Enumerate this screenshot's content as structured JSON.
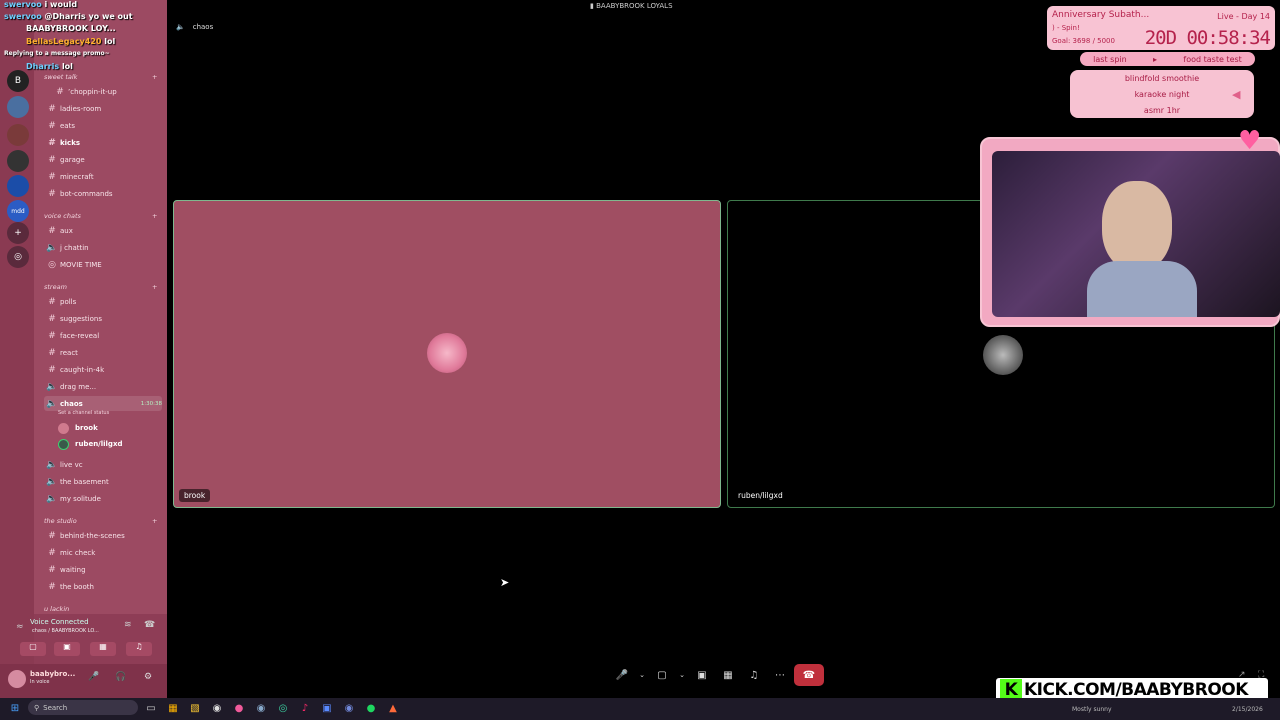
{
  "window": {
    "title": "BAABYBROOK LOYALS"
  },
  "chat": [
    {
      "user": "swervoo",
      "text": "i would"
    },
    {
      "user": "swervoo",
      "text": "@Dharris yo we out"
    },
    {
      "user": "",
      "text": "BAABYBROOK LOY..."
    },
    {
      "user": "BellasLegacy420",
      "text": "lol"
    },
    {
      "user": "",
      "text": "Replying to a message promo~"
    },
    {
      "user": "Dharris",
      "text": "lol"
    }
  ],
  "sidebar": {
    "categories": [
      {
        "label": "sweet talk",
        "channels": [
          {
            "label": "’choppin-it-up"
          },
          {
            "label": "ladies-room"
          },
          {
            "label": "eats"
          },
          {
            "label": "kicks"
          },
          {
            "label": "garage"
          },
          {
            "label": "minecraft"
          },
          {
            "label": "bot-commands"
          }
        ]
      },
      {
        "label": "voice chats",
        "channels": [
          {
            "label": "aux"
          },
          {
            "label": "j chattin"
          },
          {
            "label": "MOVIE TIME"
          }
        ]
      },
      {
        "label": "stream",
        "channels": [
          {
            "label": "polls"
          },
          {
            "label": "suggestions"
          },
          {
            "label": "face-reveal"
          },
          {
            "label": "react"
          },
          {
            "label": "caught-in-4k"
          },
          {
            "label": "drag me..."
          },
          {
            "label": "chaos"
          },
          {
            "label": "live vc"
          },
          {
            "label": "the basement"
          },
          {
            "label": "my solitude"
          }
        ]
      },
      {
        "label": "the studio",
        "channels": [
          {
            "label": "behind-the-scenes"
          },
          {
            "label": "mic check"
          },
          {
            "label": "waiting"
          },
          {
            "label": "the booth"
          }
        ]
      },
      {
        "label": "u lackin"
      }
    ],
    "active_channel_timer": "1:30:38",
    "channel_status": "Set a channel status",
    "vc_users": [
      "brook",
      "ruben/lilgxd"
    ],
    "voice_connected": "Voice Connected",
    "voice_channel_path": "chaos / BAABYBROOK LO...",
    "user": {
      "name": "baabybro...",
      "status": "In voice"
    }
  },
  "stage": {
    "channel_name": "chaos",
    "tiles": [
      {
        "name": "brook"
      },
      {
        "name": "ruben/lilgxd"
      }
    ]
  },
  "subathon": {
    "title": "Anniversary Subath...",
    "spin": ") - Spin!",
    "goal": "Goal: 3698 / 5000",
    "live": "Live - Day 14",
    "timer": "20D 00:58:34",
    "spin_bar": [
      "last spin",
      "food taste test"
    ],
    "wheel": [
      "blindfold smoothie",
      "karaoke night",
      "asmr 1hr"
    ]
  },
  "banner": {
    "text": "KICK.COM/BAABYBROOK"
  },
  "taskbar": {
    "search_placeholder": "Search",
    "weather": "Mostly sunny",
    "date": "2/15/2026"
  },
  "colors": {
    "sidebar": "#9c4a62",
    "rail": "#8a3a52",
    "tile_brook": "#a04e62",
    "accent_pink": "#f8c3d3",
    "hangup": "#c0303c",
    "kick_green": "#53fc18"
  }
}
